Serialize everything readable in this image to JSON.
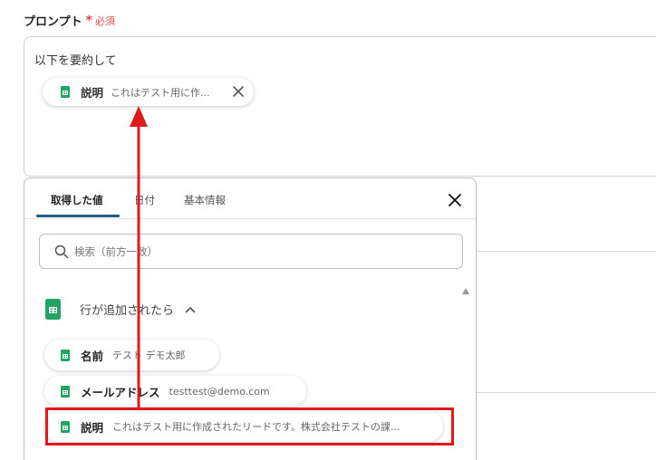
{
  "prompt_field": {
    "label": "プロンプト",
    "required_mark": "*",
    "required_text": "必須",
    "text": "以下を要約して",
    "chip": {
      "name": "説明",
      "value": "これはテスト用に作...",
      "icon": "sheet-icon"
    }
  },
  "picker": {
    "tabs": [
      {
        "label": "取得した値",
        "active": true
      },
      {
        "label": "日付",
        "active": false
      },
      {
        "label": "基本情報",
        "active": false
      }
    ],
    "search_placeholder": "検索（前方一致）",
    "group": {
      "label": "行が追加されたら",
      "icon": "google-sheets-icon",
      "expanded": true
    },
    "items": [
      {
        "name": "名前",
        "value": "テスト デモ太郎"
      },
      {
        "name": "メールアドレス",
        "value": "testtest@demo.com"
      },
      {
        "name": "説明",
        "value": "これはテスト用に作成されたリードです。株式会社テストの課..."
      }
    ]
  },
  "annotation": {
    "highlight_color": "#e01a1a",
    "arrow_color": "#e01a1a"
  },
  "colors": {
    "accent": "#1f5e7e",
    "sheets_green": "#21a464",
    "required": "#e04848"
  }
}
